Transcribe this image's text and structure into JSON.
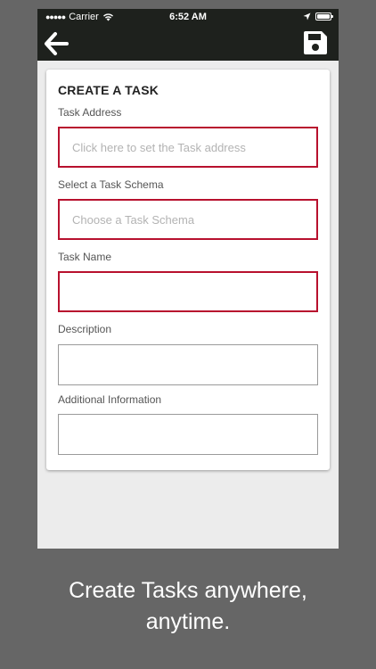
{
  "status_bar": {
    "carrier": "Carrier",
    "time": "6:52 AM"
  },
  "navbar": {
    "back_icon": "arrow-left-icon",
    "save_icon": "floppy-disk-icon"
  },
  "form": {
    "title": "CREATE A TASK",
    "fields": [
      {
        "label": "Task Address",
        "placeholder": "Click here to set the Task address",
        "value": ""
      },
      {
        "label": "Select a Task Schema",
        "placeholder": "Choose a Task Schema",
        "value": ""
      },
      {
        "label": "Task Name",
        "placeholder": "",
        "value": ""
      },
      {
        "label": "Description",
        "placeholder": "",
        "value": ""
      },
      {
        "label": "Additional Information",
        "placeholder": "",
        "value": ""
      }
    ]
  },
  "caption": {
    "line1": "Create Tasks anywhere,",
    "line2": "anytime."
  },
  "colors": {
    "background": "#666666",
    "navbar": "#1e211d",
    "required_border": "#b8112e",
    "content_bg": "#ececec"
  }
}
